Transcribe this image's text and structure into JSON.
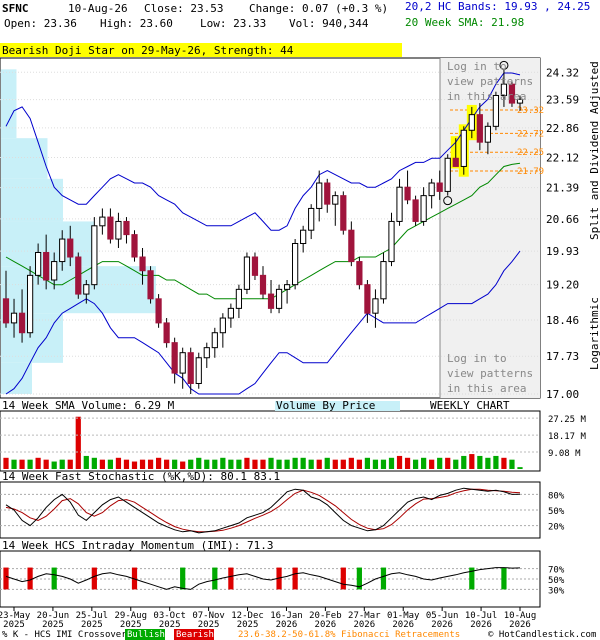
{
  "header": {
    "symbol": "SFNC",
    "date": "10-Aug-26",
    "close": "Close: 23.53",
    "change": "Change: 0.07 (+0.3 %)",
    "open": "Open: 23.36",
    "high": "High: 23.60",
    "low": "Low: 23.33",
    "vol": "Vol: 940,344",
    "bands": "20,2 HC Bands: 19.93 , 24.25",
    "sma": "20 Week SMA: 21.98"
  },
  "colors": {
    "up": "#ffffff",
    "down": "#a0143c",
    "outline": "#000000",
    "band": "#0000cc",
    "sma": "#008800",
    "vbp": "#c8f0f8",
    "fib": "#ff8800",
    "highlight": "#ffff00",
    "vol_up": "#00aa00",
    "vol_down": "#dd0000",
    "stoch_k": "#000000",
    "stoch_d": "#aa0000"
  },
  "pattern_banner": "Bearish Doji Star on 29-May-26, Strength: 44",
  "watermark_top": [
    "Log in to",
    "view patterns",
    "in this area"
  ],
  "watermark_bottom": [
    "Log in to",
    "view patterns",
    "in this area"
  ],
  "right_vertical_labels": {
    "scale": "Logarithmic",
    "adjusted": "Split and Dividend Adjusted"
  },
  "chart_data": [
    {
      "type": "candlestick",
      "title": "",
      "y_scale": "log",
      "ylim": [
        17.0,
        24.6
      ],
      "y_ticks": [
        "24.32",
        "23.59",
        "22.86",
        "22.12",
        "21.39",
        "20.66",
        "19.93",
        "19.20",
        "18.46",
        "17.73",
        "17.00"
      ],
      "fib_levels": [
        {
          "label": "23.32",
          "value": 23.32
        },
        {
          "label": "22.72",
          "value": 22.72
        },
        {
          "label": "22.25",
          "value": 22.25
        },
        {
          "label": "21.79",
          "value": 21.79
        }
      ],
      "candles": [
        {
          "o": 18.9,
          "h": 19.5,
          "l": 18.3,
          "c": 18.4
        },
        {
          "o": 18.4,
          "h": 18.9,
          "l": 18.1,
          "c": 18.6
        },
        {
          "o": 18.6,
          "h": 19.1,
          "l": 18.0,
          "c": 18.2
        },
        {
          "o": 18.2,
          "h": 19.6,
          "l": 18.1,
          "c": 19.4
        },
        {
          "o": 19.4,
          "h": 20.1,
          "l": 19.2,
          "c": 19.9
        },
        {
          "o": 19.9,
          "h": 20.3,
          "l": 19.1,
          "c": 19.3
        },
        {
          "o": 19.3,
          "h": 19.9,
          "l": 19.1,
          "c": 19.7
        },
        {
          "o": 19.7,
          "h": 20.4,
          "l": 19.5,
          "c": 20.2
        },
        {
          "o": 20.2,
          "h": 20.5,
          "l": 19.6,
          "c": 19.8
        },
        {
          "o": 19.8,
          "h": 19.9,
          "l": 18.9,
          "c": 19.0
        },
        {
          "o": 19.0,
          "h": 19.3,
          "l": 18.8,
          "c": 19.2
        },
        {
          "o": 19.2,
          "h": 20.7,
          "l": 19.1,
          "c": 20.5
        },
        {
          "o": 20.5,
          "h": 20.9,
          "l": 20.3,
          "c": 20.7
        },
        {
          "o": 20.7,
          "h": 20.9,
          "l": 20.1,
          "c": 20.2
        },
        {
          "o": 20.2,
          "h": 20.8,
          "l": 20.0,
          "c": 20.6
        },
        {
          "o": 20.6,
          "h": 20.7,
          "l": 20.1,
          "c": 20.3
        },
        {
          "o": 20.3,
          "h": 20.4,
          "l": 19.7,
          "c": 19.8
        },
        {
          "o": 19.8,
          "h": 20.0,
          "l": 19.2,
          "c": 19.5
        },
        {
          "o": 19.5,
          "h": 19.6,
          "l": 18.8,
          "c": 18.9
        },
        {
          "o": 18.9,
          "h": 19.0,
          "l": 18.3,
          "c": 18.4
        },
        {
          "o": 18.4,
          "h": 18.5,
          "l": 17.9,
          "c": 18.0
        },
        {
          "o": 18.0,
          "h": 18.1,
          "l": 17.2,
          "c": 17.4
        },
        {
          "o": 17.4,
          "h": 17.9,
          "l": 17.1,
          "c": 17.8
        },
        {
          "o": 17.8,
          "h": 17.9,
          "l": 17.0,
          "c": 17.2
        },
        {
          "o": 17.2,
          "h": 17.8,
          "l": 17.1,
          "c": 17.7
        },
        {
          "o": 17.7,
          "h": 18.0,
          "l": 17.5,
          "c": 17.9
        },
        {
          "o": 17.9,
          "h": 18.3,
          "l": 17.7,
          "c": 18.2
        },
        {
          "o": 18.2,
          "h": 18.6,
          "l": 17.9,
          "c": 18.5
        },
        {
          "o": 18.5,
          "h": 18.8,
          "l": 18.3,
          "c": 18.7
        },
        {
          "o": 18.7,
          "h": 19.2,
          "l": 18.5,
          "c": 19.1
        },
        {
          "o": 19.1,
          "h": 19.9,
          "l": 19.0,
          "c": 19.8
        },
        {
          "o": 19.8,
          "h": 19.9,
          "l": 19.3,
          "c": 19.4
        },
        {
          "o": 19.4,
          "h": 19.6,
          "l": 18.9,
          "c": 19.0
        },
        {
          "o": 19.0,
          "h": 19.3,
          "l": 18.6,
          "c": 18.7
        },
        {
          "o": 18.7,
          "h": 19.2,
          "l": 18.6,
          "c": 19.1
        },
        {
          "o": 19.1,
          "h": 19.3,
          "l": 18.8,
          "c": 19.2
        },
        {
          "o": 19.2,
          "h": 20.2,
          "l": 19.1,
          "c": 20.1
        },
        {
          "o": 20.1,
          "h": 20.5,
          "l": 19.9,
          "c": 20.4
        },
        {
          "o": 20.4,
          "h": 21.0,
          "l": 20.2,
          "c": 20.9
        },
        {
          "o": 20.9,
          "h": 21.8,
          "l": 20.6,
          "c": 21.5
        },
        {
          "o": 21.5,
          "h": 21.6,
          "l": 20.8,
          "c": 21.0
        },
        {
          "o": 21.0,
          "h": 21.3,
          "l": 20.5,
          "c": 21.2
        },
        {
          "o": 21.2,
          "h": 21.3,
          "l": 20.3,
          "c": 20.4
        },
        {
          "o": 20.4,
          "h": 20.6,
          "l": 19.6,
          "c": 19.7
        },
        {
          "o": 19.7,
          "h": 19.8,
          "l": 19.1,
          "c": 19.2
        },
        {
          "o": 19.2,
          "h": 19.3,
          "l": 18.4,
          "c": 18.6
        },
        {
          "o": 18.6,
          "h": 19.1,
          "l": 18.3,
          "c": 18.9
        },
        {
          "o": 18.9,
          "h": 19.9,
          "l": 18.8,
          "c": 19.7
        },
        {
          "o": 19.7,
          "h": 20.8,
          "l": 19.6,
          "c": 20.6
        },
        {
          "o": 20.6,
          "h": 21.6,
          "l": 20.5,
          "c": 21.4
        },
        {
          "o": 21.4,
          "h": 21.8,
          "l": 21.0,
          "c": 21.1
        },
        {
          "o": 21.1,
          "h": 21.2,
          "l": 20.5,
          "c": 20.6
        },
        {
          "o": 20.6,
          "h": 21.4,
          "l": 20.5,
          "c": 21.2
        },
        {
          "o": 21.2,
          "h": 21.6,
          "l": 20.9,
          "c": 21.5
        },
        {
          "o": 21.5,
          "h": 21.8,
          "l": 21.1,
          "c": 21.3
        },
        {
          "o": 21.3,
          "h": 22.2,
          "l": 21.2,
          "c": 22.1
        },
        {
          "o": 22.1,
          "h": 22.6,
          "l": 21.9,
          "c": 21.9
        },
        {
          "o": 21.9,
          "h": 22.9,
          "l": 21.7,
          "c": 22.8
        },
        {
          "o": 22.8,
          "h": 23.4,
          "l": 22.6,
          "c": 23.2
        },
        {
          "o": 23.2,
          "h": 23.5,
          "l": 22.3,
          "c": 22.5
        },
        {
          "o": 22.5,
          "h": 23.0,
          "l": 22.2,
          "c": 22.9
        },
        {
          "o": 22.9,
          "h": 23.8,
          "l": 22.8,
          "c": 23.7
        },
        {
          "o": 23.7,
          "h": 24.4,
          "l": 23.4,
          "c": 24.0
        },
        {
          "o": 24.0,
          "h": 24.1,
          "l": 23.4,
          "c": 23.5
        },
        {
          "o": 23.5,
          "h": 23.7,
          "l": 23.3,
          "c": 23.6
        }
      ],
      "highlight_candles": [
        56,
        57,
        58
      ],
      "pattern_marker_candle": 62,
      "support_marker_candle": 55,
      "bands_upper": [
        22.9,
        23.3,
        23.4,
        23.1,
        22.5,
        21.9,
        21.4,
        21.2,
        21.1,
        21.0,
        21.0,
        21.2,
        21.4,
        21.6,
        21.7,
        21.6,
        21.5,
        21.5,
        21.4,
        21.2,
        21.1,
        21.0,
        20.8,
        20.7,
        20.6,
        20.5,
        20.5,
        20.5,
        20.5,
        20.6,
        20.7,
        20.8,
        20.6,
        20.4,
        20.4,
        20.5,
        20.9,
        21.2,
        21.4,
        21.7,
        21.8,
        21.7,
        21.6,
        21.5,
        21.5,
        21.4,
        21.4,
        21.5,
        21.6,
        21.8,
        21.9,
        22.0,
        22.0,
        22.1,
        22.1,
        22.3,
        22.5,
        22.8,
        23.1,
        23.4,
        23.6,
        24.0,
        24.3,
        24.3,
        24.25
      ],
      "bands_lower": [
        17.0,
        17.1,
        17.3,
        17.6,
        17.9,
        18.1,
        18.4,
        18.6,
        18.7,
        18.8,
        18.9,
        18.8,
        18.6,
        18.3,
        18.1,
        18.1,
        18.1,
        18.0,
        17.9,
        17.8,
        17.6,
        17.4,
        17.3,
        17.1,
        17.0,
        17.0,
        17.0,
        17.0,
        17.0,
        17.0,
        17.1,
        17.2,
        17.4,
        17.6,
        17.8,
        17.8,
        17.7,
        17.6,
        17.6,
        17.6,
        17.6,
        17.8,
        18.0,
        18.2,
        18.4,
        18.6,
        18.5,
        18.4,
        18.4,
        18.4,
        18.4,
        18.4,
        18.5,
        18.6,
        18.7,
        18.8,
        18.8,
        18.8,
        18.8,
        18.9,
        19.0,
        19.2,
        19.5,
        19.7,
        19.93
      ],
      "sma": [
        19.8,
        19.7,
        19.6,
        19.5,
        19.4,
        19.3,
        19.2,
        19.2,
        19.3,
        19.4,
        19.5,
        19.6,
        19.7,
        19.7,
        19.7,
        19.6,
        19.5,
        19.4,
        19.4,
        19.4,
        19.3,
        19.3,
        19.2,
        19.1,
        19.0,
        19.0,
        18.9,
        18.9,
        18.9,
        18.9,
        18.9,
        18.9,
        18.9,
        18.9,
        19.0,
        19.1,
        19.2,
        19.3,
        19.4,
        19.5,
        19.6,
        19.7,
        19.7,
        19.7,
        19.8,
        19.8,
        19.8,
        19.9,
        20.0,
        20.2,
        20.4,
        20.5,
        20.6,
        20.7,
        20.8,
        20.9,
        21.0,
        21.1,
        21.2,
        21.4,
        21.5,
        21.7,
        21.9,
        21.95,
        21.98
      ],
      "volume_by_price": [
        {
          "price_low": 23.6,
          "price_high": 24.4,
          "width": 0.1
        },
        {
          "price_low": 22.6,
          "price_high": 23.6,
          "width": 0.1
        },
        {
          "price_low": 21.6,
          "price_high": 22.6,
          "width": 0.3
        },
        {
          "price_low": 20.6,
          "price_high": 21.6,
          "width": 0.4
        },
        {
          "price_low": 19.6,
          "price_high": 20.6,
          "width": 0.6
        },
        {
          "price_low": 18.6,
          "price_high": 19.6,
          "width": 1.0
        },
        {
          "price_low": 17.6,
          "price_high": 18.6,
          "width": 0.4
        },
        {
          "price_low": 17.0,
          "price_high": 17.6,
          "width": 0.2
        }
      ]
    },
    {
      "type": "bar",
      "title": "14 Week SMA Volume: 6.29 M",
      "center_label": "Volume By Price",
      "right_label": "WEEKLY CHART",
      "y_ticks": [
        "27.25 M",
        "18.17 M",
        "9.08 M"
      ],
      "ylim": [
        0,
        30
      ],
      "values": [
        6,
        5,
        5,
        5,
        6,
        5,
        4,
        5,
        5,
        28,
        7,
        6,
        5,
        5,
        6,
        5,
        4,
        5,
        5,
        6,
        5,
        5,
        4,
        5,
        6,
        5,
        5,
        6,
        5,
        5,
        6,
        5,
        5,
        6,
        5,
        5,
        6,
        6,
        5,
        5,
        6,
        5,
        5,
        6,
        5,
        6,
        5,
        5,
        6,
        7,
        6,
        5,
        6,
        5,
        6,
        6,
        5,
        7,
        8,
        7,
        6,
        7,
        6,
        5,
        1
      ],
      "up": [
        0,
        1,
        0,
        1,
        0,
        0,
        1,
        1,
        0,
        0,
        1,
        1,
        0,
        1,
        0,
        0,
        0,
        0,
        0,
        0,
        0,
        1,
        0,
        1,
        1,
        1,
        1,
        1,
        1,
        1,
        0,
        0,
        0,
        1,
        1,
        1,
        1,
        1,
        1,
        0,
        1,
        0,
        0,
        0,
        0,
        1,
        1,
        1,
        1,
        0,
        0,
        1,
        1,
        0,
        1,
        0,
        1,
        1,
        0,
        1,
        1,
        1,
        0,
        1,
        1
      ]
    },
    {
      "type": "line",
      "title": "14 Week Fast Stochastic (%K,%D): 80.1 83.1",
      "y_ticks": [
        "80%",
        "50%",
        "20%"
      ],
      "ylim": [
        0,
        100
      ],
      "series": [
        {
          "name": "",
          "values": [
            60,
            50,
            30,
            20,
            35,
            55,
            70,
            80,
            65,
            40,
            30,
            45,
            60,
            70,
            75,
            65,
            55,
            45,
            35,
            25,
            18,
            12,
            8,
            10,
            6,
            8,
            10,
            15,
            20,
            25,
            35,
            40,
            45,
            55,
            70,
            85,
            90,
            88,
            75,
            70,
            60,
            45,
            30,
            20,
            15,
            10,
            12,
            20,
            35,
            50,
            65,
            72,
            75,
            70,
            78,
            82,
            88,
            92,
            90,
            88,
            86,
            88,
            85,
            80,
            80.1
          ]
        },
        {
          "name": "",
          "values": [
            55,
            52,
            45,
            35,
            30,
            38,
            52,
            68,
            72,
            62,
            45,
            38,
            45,
            58,
            68,
            70,
            65,
            55,
            45,
            35,
            26,
            18,
            13,
            10,
            8,
            8,
            9,
            11,
            15,
            20,
            27,
            34,
            40,
            47,
            57,
            70,
            82,
            88,
            84,
            78,
            68,
            58,
            45,
            32,
            22,
            15,
            12,
            14,
            22,
            35,
            50,
            62,
            71,
            72,
            74,
            77,
            83,
            87,
            90,
            90,
            88,
            87,
            86,
            84,
            83.1
          ]
        }
      ]
    },
    {
      "type": "line",
      "title": "14 Week HCS Intraday Momentum (IMI): 71.3",
      "y_ticks": [
        "70%",
        "50%",
        "30%"
      ],
      "ylim": [
        0,
        100
      ],
      "series": [
        {
          "name": "",
          "values": [
            55,
            50,
            45,
            48,
            55,
            60,
            58,
            55,
            50,
            42,
            48,
            55,
            60,
            62,
            58,
            55,
            50,
            45,
            40,
            35,
            30,
            35,
            32,
            30,
            40,
            45,
            48,
            52,
            55,
            58,
            60,
            55,
            50,
            48,
            52,
            55,
            60,
            62,
            58,
            55,
            50,
            45,
            40,
            38,
            35,
            42,
            50,
            55,
            60,
            62,
            58,
            55,
            50,
            48,
            52,
            55,
            58,
            62,
            65,
            68,
            70,
            72,
            72,
            71,
            71.3
          ]
        }
      ],
      "bullish_markers": [
        6,
        22,
        26,
        44,
        47,
        58,
        62
      ],
      "bearish_markers": [
        0,
        3,
        11,
        16,
        28,
        34,
        36,
        42
      ]
    }
  ],
  "x_axis_labels": [
    [
      "23-May",
      "2025"
    ],
    [
      "20-Jun",
      "2025"
    ],
    [
      "25-Jul",
      "2025"
    ],
    [
      "29-Aug",
      "2025"
    ],
    [
      "03-Oct",
      "2025"
    ],
    [
      "07-Nov",
      "2025"
    ],
    [
      "12-Dec",
      "2025"
    ],
    [
      "16-Jan",
      "2026"
    ],
    [
      "20-Feb",
      "2026"
    ],
    [
      "27-Mar",
      "2026"
    ],
    [
      "01-May",
      "2026"
    ],
    [
      "05-Jun",
      "2026"
    ],
    [
      "10-Jul",
      "2026"
    ],
    [
      "10-Aug",
      "2026"
    ]
  ],
  "footer": {
    "legend_text": "% K - HCS IMI Crossover:",
    "bullish": "Bullish",
    "bearish": "Bearish",
    "fib_text": "23.6-38.2-50-61.8% Fibonacci Retracements",
    "copyright": "© HotCandlestick.com"
  }
}
